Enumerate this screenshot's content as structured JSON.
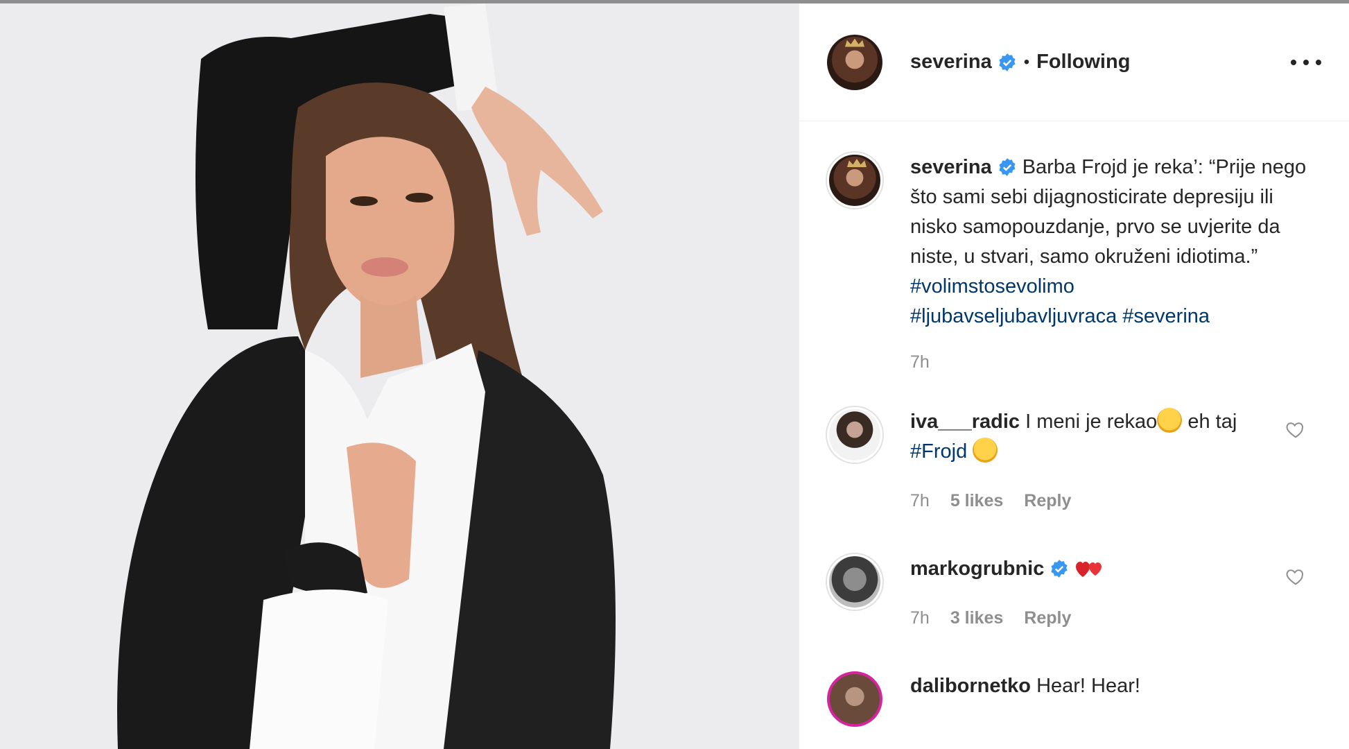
{
  "post": {
    "author": "severina",
    "follow_status": "Following",
    "separator": "•",
    "caption": {
      "username": "severina",
      "text": "Barba Frojd je reka’: “Prije nego što sami sebi dijagnosticirate depresiju ili nisko samopouzdanje, prvo se uvjerite da niste, u stvari, samo okruženi idiotima.”",
      "hashtags": [
        "#volimstosevolimo",
        "#ljubavseljubavljuvraca",
        "#severina"
      ],
      "time": "7h"
    }
  },
  "comments": [
    {
      "username": "iva___radic",
      "text_before": "I meni je rekao",
      "text_middle": " eh taj ",
      "hashtag": "#Frojd",
      "emojis": [
        "wink-emoji",
        "laughing-emoji"
      ],
      "time": "7h",
      "likes": "5 likes",
      "reply": "Reply"
    },
    {
      "username": "markogrubnic",
      "verified": true,
      "emojis": [
        "two-hearts-emoji"
      ],
      "time": "7h",
      "likes": "3 likes",
      "reply": "Reply"
    },
    {
      "username": "dalibornetko",
      "text": "Hear! Hear!"
    }
  ],
  "colors": {
    "hashtag": "#00376b",
    "verified": "#3897f0",
    "muted": "#8e8e8e",
    "text": "#262626"
  },
  "icons": [
    "verified-badge-icon",
    "more-options-icon",
    "heart-icon"
  ]
}
